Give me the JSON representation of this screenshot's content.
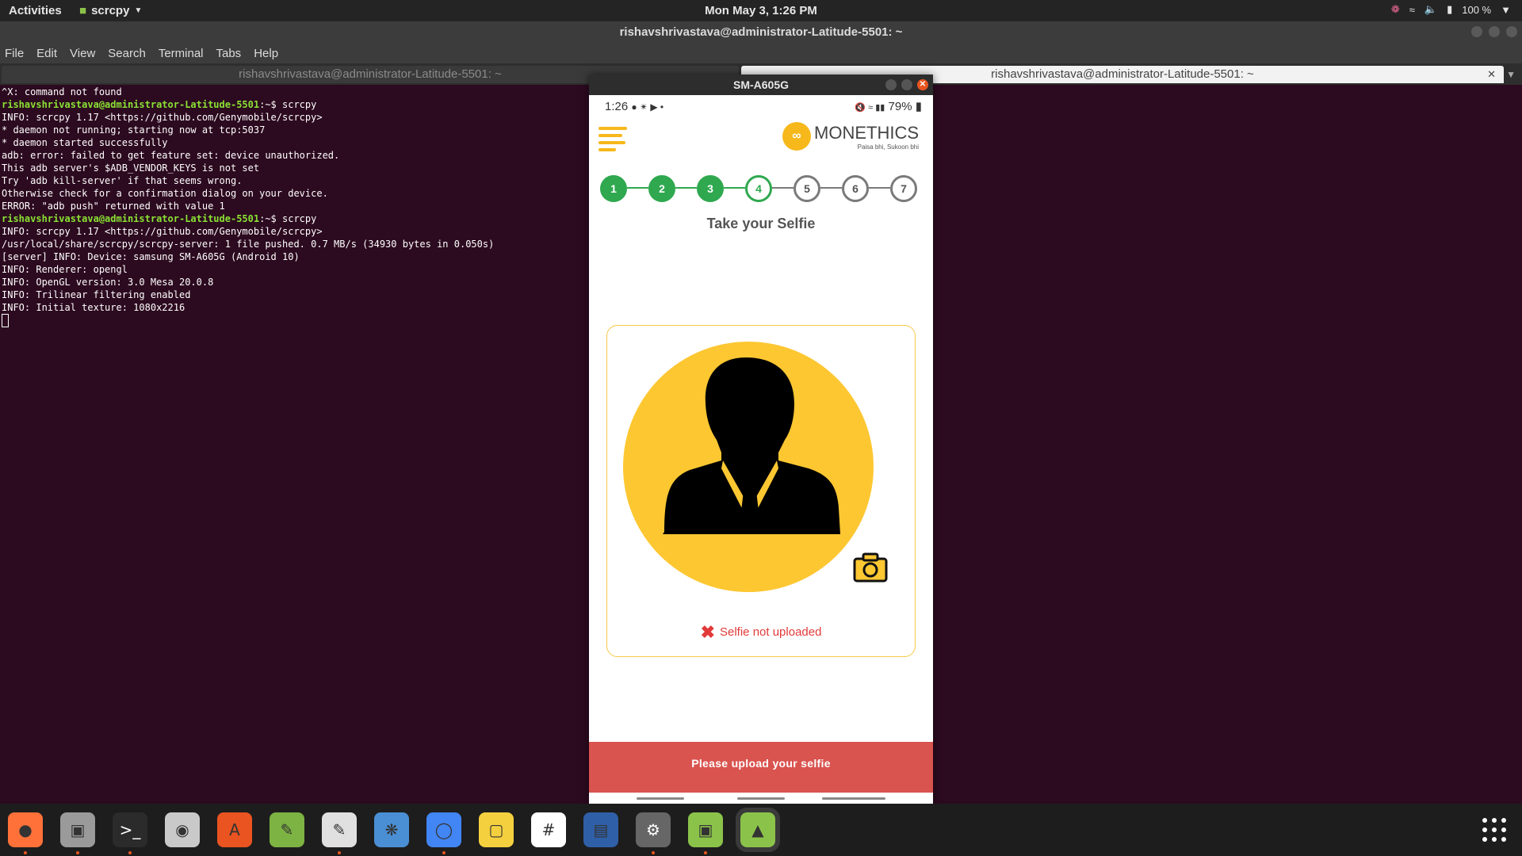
{
  "topbar": {
    "activities": "Activities",
    "app_name": "scrcpy",
    "clock": "Mon May  3,  1:26 PM",
    "battery": "100 %"
  },
  "terminal": {
    "title": "rishavshrivastava@administrator-Latitude-5501: ~",
    "menu": [
      "File",
      "Edit",
      "View",
      "Search",
      "Terminal",
      "Tabs",
      "Help"
    ],
    "tabs": [
      "rishavshrivastava@administrator-Latitude-5501: ~",
      "rishavshrivastava@administrator-Latitude-5501: ~"
    ],
    "lines": [
      {
        "type": "text",
        "text": "^X: command not found"
      },
      {
        "type": "prompt",
        "prompt": "rishavshrivastava@administrator-Latitude-5501",
        "cmd": ":~$ scrcpy"
      },
      {
        "type": "text",
        "text": "INFO: scrcpy 1.17 <https://github.com/Genymobile/scrcpy>"
      },
      {
        "type": "text",
        "text": "* daemon not running; starting now at tcp:5037"
      },
      {
        "type": "text",
        "text": "* daemon started successfully"
      },
      {
        "type": "text",
        "text": "adb: error: failed to get feature set: device unauthorized."
      },
      {
        "type": "text",
        "text": "This adb server's $ADB_VENDOR_KEYS is not set"
      },
      {
        "type": "text",
        "text": "Try 'adb kill-server' if that seems wrong."
      },
      {
        "type": "text",
        "text": "Otherwise check for a confirmation dialog on your device."
      },
      {
        "type": "text",
        "text": "ERROR: \"adb push\" returned with value 1"
      },
      {
        "type": "prompt",
        "prompt": "rishavshrivastava@administrator-Latitude-5501",
        "cmd": ":~$ scrcpy"
      },
      {
        "type": "text",
        "text": "INFO: scrcpy 1.17 <https://github.com/Genymobile/scrcpy>"
      },
      {
        "type": "text",
        "text": "/usr/local/share/scrcpy/scrcpy-server: 1 file pushed. 0.7 MB/s (34930 bytes in 0.050s)"
      },
      {
        "type": "text",
        "text": "[server] INFO: Device: samsung SM-A605G (Android 10)"
      },
      {
        "type": "text",
        "text": "INFO: Renderer: opengl"
      },
      {
        "type": "text",
        "text": "INFO: OpenGL version: 3.0 Mesa 20.0.8"
      },
      {
        "type": "text",
        "text": "INFO: Trilinear filtering enabled"
      },
      {
        "type": "text",
        "text": "INFO: Initial texture: 1080x2216"
      }
    ]
  },
  "phone": {
    "window_title": "SM-A605G",
    "status": {
      "time": "1:26",
      "battery": "79%"
    },
    "brand": {
      "name": "MONETHICS",
      "tagline": "Paisa bhi, Sukoon bhi"
    },
    "steps": [
      {
        "label": "1",
        "state": "done"
      },
      {
        "label": "2",
        "state": "done"
      },
      {
        "label": "3",
        "state": "done"
      },
      {
        "label": "4",
        "state": "current"
      },
      {
        "label": "5",
        "state": "todo"
      },
      {
        "label": "6",
        "state": "todo"
      },
      {
        "label": "7",
        "state": "todo"
      }
    ],
    "heading": "Take your Selfie",
    "upload_status": "Selfie not uploaded",
    "cta": "Please upload your selfie"
  },
  "colors": {
    "accent": "#2fa84f",
    "brand_yellow": "#fdc732",
    "cta": "#d9534f",
    "error": "#e23a3a"
  },
  "dock": {
    "apps": [
      "firefox-icon",
      "files-icon",
      "terminal-icon",
      "rhythmbox-icon",
      "software-icon",
      "editor-icon",
      "text-editor-icon",
      "screenshot-icon",
      "chrome-icon",
      "notes-icon",
      "slack-icon",
      "writer-icon",
      "java-ee-ide-icon",
      "image-viewer-icon",
      "android-icon"
    ]
  }
}
